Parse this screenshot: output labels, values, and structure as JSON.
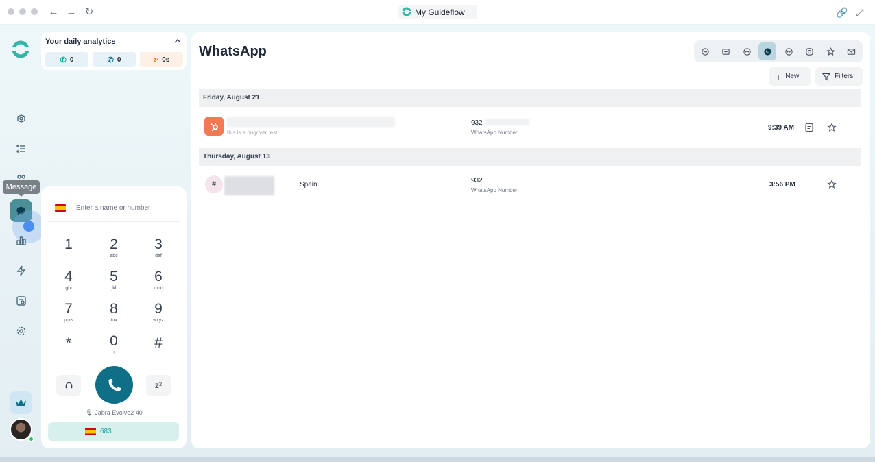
{
  "browser": {
    "tab_title": "My Guideflow"
  },
  "sidebar": {
    "tooltip": "Message"
  },
  "analytics": {
    "title": "Your daily analytics",
    "pills": [
      {
        "icon": "incoming-call-icon",
        "value": "0",
        "color": "#0ea5a0"
      },
      {
        "icon": "outgoing-call-icon",
        "value": "0",
        "color": "#0f6f86"
      },
      {
        "icon": "snooze-icon",
        "value": "0s",
        "color": "#f97316"
      }
    ]
  },
  "dialer": {
    "placeholder": "Enter a name or number",
    "keys": [
      {
        "digit": "1",
        "sub": ""
      },
      {
        "digit": "2",
        "sub": "abc"
      },
      {
        "digit": "3",
        "sub": "def"
      },
      {
        "digit": "4",
        "sub": "ghi"
      },
      {
        "digit": "5",
        "sub": "jkl"
      },
      {
        "digit": "6",
        "sub": "mno"
      },
      {
        "digit": "7",
        "sub": "pqrs"
      },
      {
        "digit": "8",
        "sub": "tuv"
      },
      {
        "digit": "9",
        "sub": "wxyz"
      },
      {
        "digit": "*",
        "sub": ""
      },
      {
        "digit": "0",
        "sub": "+"
      },
      {
        "digit": "#",
        "sub": ""
      }
    ],
    "snooze_label": "z²",
    "device": "Jabra Evolve2 40",
    "number": "683"
  },
  "main": {
    "title": "WhatsApp",
    "channels": [
      "chat",
      "sms",
      "group",
      "whatsapp",
      "messenger",
      "instagram",
      "star",
      "email"
    ],
    "active_channel": "whatsapp",
    "new_label": "New",
    "filters_label": "Filters",
    "groups": [
      {
        "date": "Friday, August 21",
        "conversations": [
          {
            "avatar": "hubspot-icon",
            "preview": "this is a ringover test",
            "number": "932",
            "number_type": "WhatsApp Number",
            "time": "9:39 AM",
            "has_note": true
          }
        ]
      },
      {
        "date": "Thursday, August 13",
        "conversations": [
          {
            "avatar": "hash-icon",
            "avatar_text": "#",
            "country": "Spain",
            "number": "932",
            "number_type": "WhatsApp Number",
            "time": "3:56 PM",
            "has_note": false
          }
        ]
      }
    ]
  }
}
